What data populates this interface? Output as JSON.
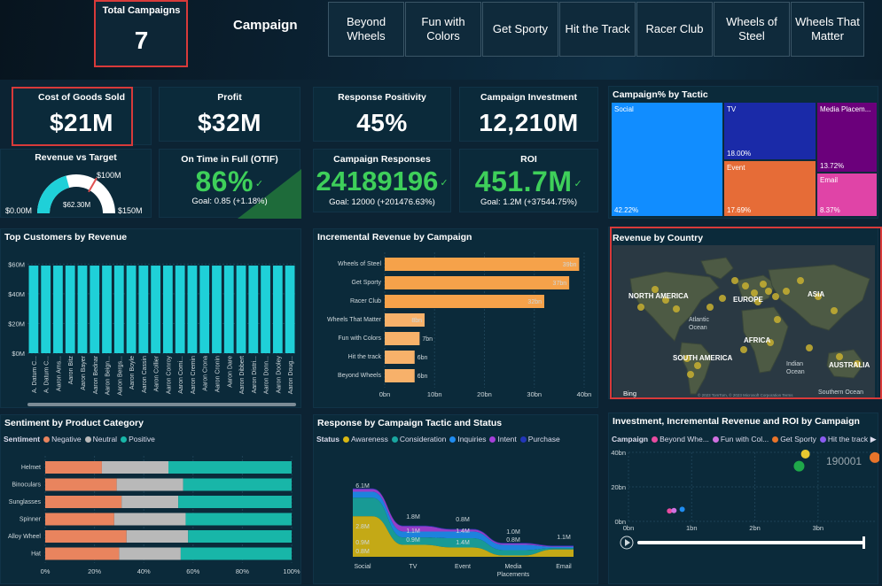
{
  "header": {
    "total_campaigns_label": "Total Campaigns",
    "total_campaigns_value": "7",
    "title": "Campaign",
    "tabs": [
      "Beyond\nWheels",
      "Fun with\nColors",
      "Get Sporty",
      "Hit the Track",
      "Racer Club",
      "Wheels of\nSteel",
      "Wheels That\nMatter"
    ]
  },
  "kpis": {
    "cogs": {
      "label": "Cost of Goods Sold",
      "value": "$21M"
    },
    "profit": {
      "label": "Profit",
      "value": "$32M"
    },
    "response_positivity": {
      "label": "Response Positivity",
      "value": "45%"
    },
    "campaign_investment": {
      "label": "Campaign Investment",
      "value": "12,210M"
    },
    "otif": {
      "label": "On Time in Full (OTIF)",
      "value": "86%",
      "goal": "Goal: 0.85 (+1.18%)"
    },
    "campaign_responses": {
      "label": "Campaign Responses",
      "value": "24189196",
      "goal": "Goal: 12000 (+201476.63%)"
    },
    "roi": {
      "label": "ROI",
      "value": "451.7M",
      "goal": "Goal: 1.2M (+37544.75%)"
    }
  },
  "gauge": {
    "title": "Revenue vs Target",
    "min_label": "$0.00M",
    "max_label": "$150M",
    "target_label": "$100M",
    "value_label": "$62.30M",
    "value": 62.3,
    "min": 0,
    "max": 150,
    "target": 100,
    "color": "#1fd0d8",
    "track_color": "#ffffff"
  },
  "treemap": {
    "title": "Campaign% by Tactic",
    "items": [
      {
        "name": "Social",
        "pct": "42.22%",
        "color": "#118dff"
      },
      {
        "name": "TV",
        "pct": "18.00%",
        "color": "#1a2aa8"
      },
      {
        "name": "Event",
        "pct": "17.69%",
        "color": "#e66c37"
      },
      {
        "name": "Media Placem...",
        "pct": "13.72%",
        "color": "#6b007b"
      },
      {
        "name": "Email",
        "pct": "8.37%",
        "color": "#e044a7"
      }
    ]
  },
  "top_customers": {
    "title": "Top Customers by Revenue",
    "y_ticks": [
      "$60M",
      "$40M",
      "$20M",
      "$0M"
    ],
    "customers": [
      "A. Datum C...",
      "A. Datum C...",
      "Aaron Ams...",
      "Aaron Bitz",
      "Aaron Bayer",
      "Aaron Bednar",
      "Aaron Beign...",
      "Aaron Bergs...",
      "Aaron Boyle",
      "Aaron Cassin",
      "Aaron Collier",
      "Aaron Conroy",
      "Aaron Comi...",
      "Aaron Cremin",
      "Aaron Crona",
      "Aaron Cronin",
      "Aaron Dare",
      "Aaron Dibbert",
      "Aaron Distri...",
      "Aaron Donn...",
      "Aaron Dooley",
      "Aaron Doug..."
    ],
    "value": 59
  },
  "chart_data": [
    {
      "type": "bar",
      "title": "Incremental Revenue by Campaign",
      "categories": [
        "Wheels of Steel",
        "Get Sporty",
        "Racer Club",
        "Wheels That Matter",
        "Fun with Colors",
        "Hit the track",
        "Beyond Wheels"
      ],
      "values": [
        39,
        37,
        32,
        8,
        7,
        6,
        6
      ],
      "data_labels": [
        "39bn",
        "37bn",
        "32bn",
        "8bn",
        "7bn",
        "6bn",
        "6bn"
      ],
      "x_ticks": [
        "0bn",
        "10bn",
        "20bn",
        "30bn",
        "40bn"
      ],
      "xlim": [
        0,
        40
      ],
      "color": "#f6a24a"
    },
    {
      "type": "bar",
      "title": "Sentiment by Product Category",
      "legend_title": "Sentiment",
      "categories": [
        "Helmet",
        "Binoculars",
        "Sunglasses",
        "Spinner",
        "Alloy Wheel",
        "Hat"
      ],
      "series": [
        {
          "name": "Negative",
          "color": "#e9845e",
          "values": [
            23,
            29,
            31,
            28,
            33,
            30
          ]
        },
        {
          "name": "Neutral",
          "color": "#b9b9b9",
          "values": [
            27,
            27,
            23,
            29,
            25,
            25
          ]
        },
        {
          "name": "Positive",
          "color": "#18b6a8",
          "values": [
            50,
            44,
            46,
            43,
            42,
            45
          ]
        }
      ],
      "x_ticks": [
        "0%",
        "20%",
        "40%",
        "60%",
        "80%",
        "100%"
      ]
    },
    {
      "type": "area",
      "title": "Response by Campaign Tactic and Status",
      "legend_title": "Status",
      "categories": [
        "Social",
        "TV",
        "Event",
        "Media\nPlacements",
        "Email"
      ],
      "series": [
        {
          "name": "Awareness",
          "color": "#d8b713",
          "values": [
            6.1,
            1.8,
            1.4,
            0.2,
            1.1
          ]
        },
        {
          "name": "Consideration",
          "color": "#1aa6a0",
          "values": [
            2.8,
            1.1,
            1.4,
            0.8,
            0.2
          ]
        },
        {
          "name": "Inquiries",
          "color": "#1f8cf0",
          "values": [
            0.9,
            0.9,
            1.0,
            0.8,
            0.2
          ]
        },
        {
          "name": "Intent",
          "color": "#a53fd8",
          "values": [
            0.4,
            0.8,
            0.3,
            0.2,
            0.1
          ]
        },
        {
          "name": "Purchase",
          "color": "#2236b8",
          "values": [
            0.1,
            0.1,
            0.1,
            0.1,
            0.1
          ]
        }
      ],
      "labels": [
        "6.1M",
        "2.8M",
        "0.9M",
        "1.8M",
        "1.1M",
        "0.9M",
        "0.8M",
        "1.4M",
        "1.4M",
        "1.0M",
        "0.8M",
        "1.1M"
      ]
    },
    {
      "type": "scatter",
      "title": "Investment, Incremental Revenue and ROI by Campaign",
      "legend_title": "Campaign",
      "legend": [
        {
          "name": "Beyond Whe...",
          "color": "#e84ca0"
        },
        {
          "name": "Fun with Col...",
          "color": "#d070e0"
        },
        {
          "name": "Get Sporty",
          "color": "#e8742a"
        },
        {
          "name": "Hit the track",
          "color": "#8a5cf0"
        }
      ],
      "x_ticks": [
        "0bn",
        "1bn",
        "2bn",
        "3bn"
      ],
      "y_ticks": [
        "40bn",
        "20bn",
        "0bn"
      ],
      "xlim": [
        0,
        3.9
      ],
      "ylim": [
        0,
        40
      ],
      "points": [
        {
          "x": 2.8,
          "y": 39,
          "r": 5,
          "color": "#e8c830"
        },
        {
          "x": 2.7,
          "y": 32,
          "r": 6,
          "color": "#1fa84a"
        },
        {
          "x": 3.9,
          "y": 37,
          "r": 6,
          "color": "#e8742a"
        },
        {
          "x": 0.65,
          "y": 6,
          "r": 3,
          "color": "#e84ca0"
        },
        {
          "x": 0.72,
          "y": 6.3,
          "r": 3,
          "color": "#d070e0"
        },
        {
          "x": 0.85,
          "y": 7,
          "r": 3,
          "color": "#1f8cf0"
        }
      ],
      "annotation": "190001"
    }
  ],
  "map": {
    "title": "Revenue by Country",
    "labels": [
      "NORTH AMERICA",
      "EUROPE",
      "ASIA",
      "AFRICA",
      "SOUTH AMERICA",
      "AUSTRALIA",
      "Atlantic\nOcean",
      "Indian\nOcean",
      "Southern Ocean"
    ],
    "brand": "Bing",
    "copyright": "© 2023 TomTom, © 2023 Microsoft Corporation Terms"
  }
}
